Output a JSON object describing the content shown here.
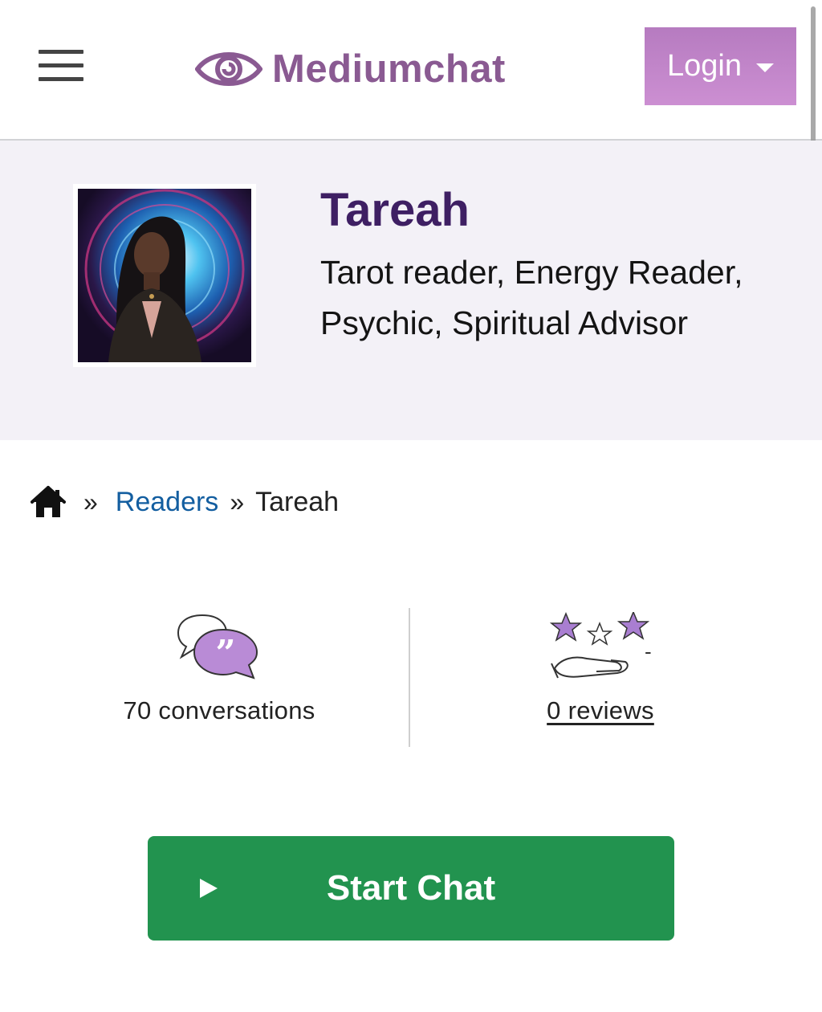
{
  "header": {
    "brand_name": "Mediumchat",
    "login_label": "Login",
    "menu_icon": "hamburger-menu-icon",
    "logo_icon": "eye-icon",
    "brand_color": "#8a5a92",
    "login_bg": "#c487cb"
  },
  "profile": {
    "name": "Tareah",
    "skills": "Tarot reader, Energy Reader, Psychic, Spiritual Advisor",
    "name_color": "#3e1f63"
  },
  "breadcrumb": {
    "home_icon": "home-icon",
    "separator": "»",
    "readers_label": "Readers",
    "current": "Tareah"
  },
  "stats": {
    "conversations_icon": "chat-bubbles-icon",
    "conversations_label": "70 conversations",
    "reviews_icon": "stars-hand-icon",
    "reviews_label": "0 reviews",
    "rating": "-"
  },
  "cta": {
    "start_chat_label": "Start Chat",
    "play_icon": "play-icon",
    "color": "#22934f"
  }
}
